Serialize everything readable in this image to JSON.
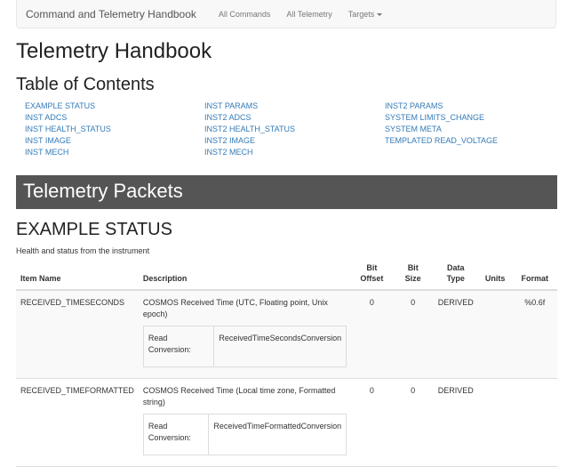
{
  "navbar": {
    "brand": "Command and Telemetry Handbook",
    "links": [
      "All Commands",
      "All Telemetry",
      "Targets"
    ]
  },
  "page_title": "Telemetry Handbook",
  "toc": {
    "title": "Table of Contents",
    "columns": [
      [
        "EXAMPLE STATUS",
        "INST ADCS",
        "INST HEALTH_STATUS",
        "INST IMAGE",
        "INST MECH"
      ],
      [
        "INST PARAMS",
        "INST2 ADCS",
        "INST2 HEALTH_STATUS",
        "INST2 IMAGE",
        "INST2 MECH"
      ],
      [
        "INST2 PARAMS",
        "SYSTEM LIMITS_CHANGE",
        "SYSTEM META",
        "TEMPLATED READ_VOLTAGE"
      ]
    ]
  },
  "section_title": "Telemetry Packets",
  "packet": {
    "title": "EXAMPLE STATUS",
    "description": "Health and status from the instrument",
    "headers": {
      "item": "Item Name",
      "description": "Description",
      "bit_offset_1": "Bit",
      "bit_offset_2": "Offset",
      "bit_size_1": "Bit",
      "bit_size_2": "Size",
      "data_type_1": "Data",
      "data_type_2": "Type",
      "units": "Units",
      "format": "Format"
    },
    "rows": [
      {
        "name": "RECEIVED_TIMESECONDS",
        "description": "COSMOS Received Time (UTC, Floating point, Unix epoch)",
        "conv_label": "Read Conversion:",
        "conv_value": "ReceivedTimeSecondsConversion",
        "bit_offset": "0",
        "bit_size": "0",
        "data_type": "DERIVED",
        "units": "",
        "format": "%0.6f"
      },
      {
        "name": "RECEIVED_TIMEFORMATTED",
        "description": "COSMOS Received Time (Local time zone, Formatted string)",
        "conv_label": "Read Conversion:",
        "conv_value": "ReceivedTimeFormattedConversion",
        "bit_offset": "0",
        "bit_size": "0",
        "data_type": "DERIVED",
        "units": "",
        "format": ""
      }
    ]
  }
}
